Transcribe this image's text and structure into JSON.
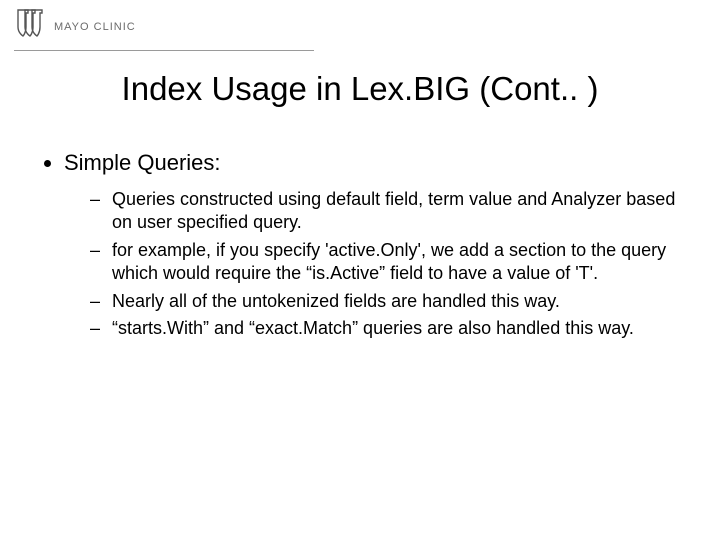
{
  "logo_text": "MAYO CLINIC",
  "title": "Index Usage in Lex.BIG (Cont.. )",
  "bullets": {
    "top": "Simple Queries:",
    "sub": [
      "Queries constructed using default field, term value and Analyzer based on user specified query.",
      "for example, if you specify 'active.Only', we add a section to the query which would require the “is.Active” field to have a value of 'T'.",
      "Nearly all of the untokenized fields are handled this way.",
      "“starts.With” and “exact.Match” queries are also handled this way."
    ]
  }
}
